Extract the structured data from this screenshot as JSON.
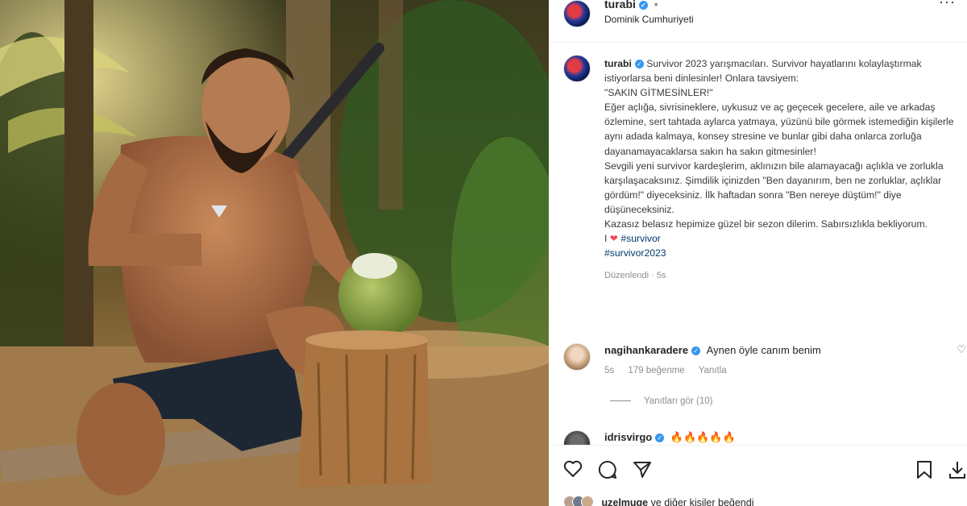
{
  "post": {
    "username": "turabi",
    "location": "Dominik Cumhuriyeti",
    "caption": {
      "lines": [
        "Survivor 2023 yarışmacıları. Survivor hayatlarını kolaylaştırmak istiyorlarsa beni dinlesinler! Onlara tavsiyem:",
        "\"SAKIN GİTMESİNLER!\"",
        "Eğer açlığa, sivrisineklere, uykusuz ve aç geçecek gecelere, aile ve arkadaş özlemine, sert tahtada aylarca yatmaya, yüzünü bile görmek istemediğin kişilerle aynı adada kalmaya, konsey stresine ve bunlar gibi daha onlarca zorluğa dayanamayacaklarsa sakın ha sakın gitmesinler!",
        "Sevgili yeni survivor kardeşlerim, aklınızın bile alamayacağı açlıkla ve zorlukla karşılaşacaksınız. Şimdilik içinizden \"Ben dayanırım, ben ne zorluklar, açlıklar gördüm!\" diyeceksiniz. İlk haftadan sonra \"Ben nereye düştüm!\" diye düşüneceksiniz.",
        "Kazasız belasız hepimize güzel bir sezon dilerim. Sabırsızlıkla bekliyorum."
      ],
      "heart_prefix": "I",
      "hashtags": [
        "#survivor",
        "#survivor2023"
      ]
    },
    "edited_label": "Düzenlendi · 5s"
  },
  "comments": [
    {
      "username": "nagihankaradere",
      "text": "Aynen öyle canım benim",
      "time": "5s",
      "likes": "179 beğenme",
      "reply": "Yanıtla",
      "view_replies": "Yanıtları gör (10)"
    },
    {
      "username": "idrisvirgo",
      "text": "🔥🔥🔥🔥🔥"
    }
  ],
  "footer": {
    "liked_by_user": "uzelmuge",
    "liked_by_rest": "ve diğer kişiler beğendi"
  },
  "colors": {
    "accent_blue": "#3897f0",
    "hashtag": "#00376b",
    "heart": "#ed4956",
    "muted": "#8e8e8e"
  },
  "icons": [
    "more-icon",
    "verified-icon",
    "like-icon",
    "comment-icon",
    "share-icon",
    "save-icon",
    "download-icon"
  ]
}
